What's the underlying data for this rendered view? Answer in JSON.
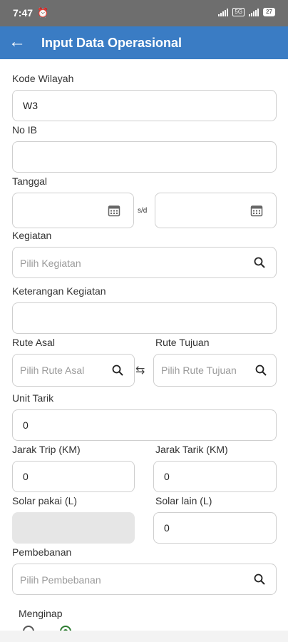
{
  "status": {
    "time": "7:47",
    "network_badge": "5G",
    "battery": "27"
  },
  "appbar": {
    "title": "Input Data Operasional"
  },
  "form": {
    "kode_wilayah": {
      "label": "Kode Wilayah",
      "value": "W3"
    },
    "no_ib": {
      "label": "No IB",
      "value": ""
    },
    "tanggal": {
      "label": "Tanggal",
      "separator": "s/d"
    },
    "kegiatan": {
      "label": "Kegiatan",
      "placeholder": "Pilih Kegiatan"
    },
    "keterangan": {
      "label": "Keterangan Kegiatan",
      "value": ""
    },
    "rute_asal": {
      "label": "Rute Asal",
      "placeholder": "Pilih Rute Asal"
    },
    "rute_tujuan": {
      "label": "Rute Tujuan",
      "placeholder": "Pilih Rute Tujuan"
    },
    "unit_tarik": {
      "label": "Unit Tarik",
      "value": "0"
    },
    "jarak_trip": {
      "label": "Jarak Trip (KM)",
      "value": "0"
    },
    "jarak_tarik": {
      "label": "Jarak Tarik (KM)",
      "value": "0"
    },
    "solar_pakai": {
      "label": "Solar pakai (L)",
      "value": ""
    },
    "solar_lain": {
      "label": "Solar lain (L)",
      "value": "0"
    },
    "pembebanan": {
      "label": "Pembebanan",
      "placeholder": "Pilih Pembebanan"
    },
    "menginap": {
      "label": "Menginap",
      "selected_option_index": 1
    }
  },
  "icons": {
    "back": "arrow-left-icon",
    "calendar": "calendar-icon",
    "search": "search-icon",
    "swap": "swap-icon"
  },
  "colors": {
    "appbar": "#3a7cc4",
    "statusbar": "#6e6e6e",
    "radio_selected": "#2e7d32"
  }
}
